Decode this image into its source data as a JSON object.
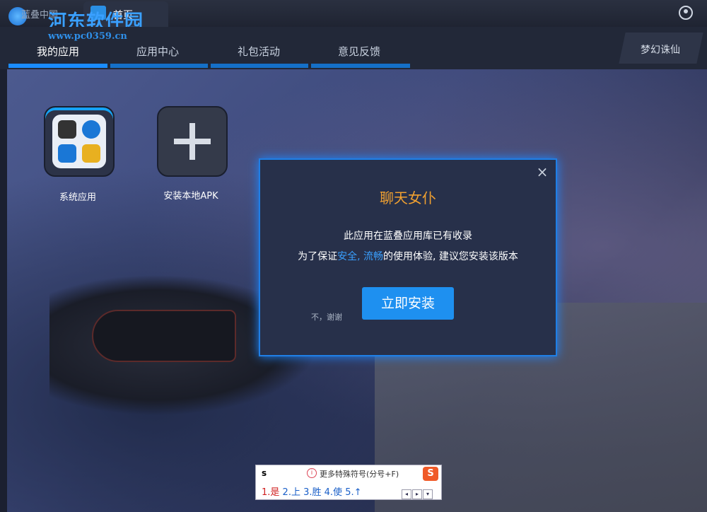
{
  "titlebar": {
    "inactive_tab": "蓝叠中国",
    "home_tab": "首页"
  },
  "watermark": {
    "brand": "河东软件园",
    "url": "www.pc0359.cn"
  },
  "nav": {
    "items": [
      {
        "label": "我的应用",
        "active": true
      },
      {
        "label": "应用中心",
        "active": false
      },
      {
        "label": "礼包活动",
        "active": false
      },
      {
        "label": "意见反馈",
        "active": false
      }
    ],
    "right_label": "梦幻诛仙"
  },
  "apps": [
    {
      "label": "系统应用"
    },
    {
      "label": "安装本地APK"
    }
  ],
  "dialog": {
    "title": "聊天女仆",
    "line1": "此应用在蓝叠应用库已有收录",
    "line2_pre": "为了保证",
    "line2_hl1": "安全",
    "line2_sep": ", ",
    "line2_hl2": "流畅",
    "line2_post": "的使用体验, 建议您安装该版本",
    "decline": "不，谢谢",
    "install": "立即安装",
    "close": "×"
  },
  "ime": {
    "input": "s",
    "hint": "更多特殊符号(分号+F)",
    "info": "i",
    "logo": "S",
    "candidates": [
      "1.是",
      "2.上",
      "3.胜",
      "4.使",
      "5.↑"
    ],
    "arrows": [
      "◂",
      "▸",
      "▾"
    ]
  },
  "colors": {
    "accent": "#1a8cff",
    "dialog_title": "#f0a030",
    "highlight": "#3aa0ff"
  }
}
